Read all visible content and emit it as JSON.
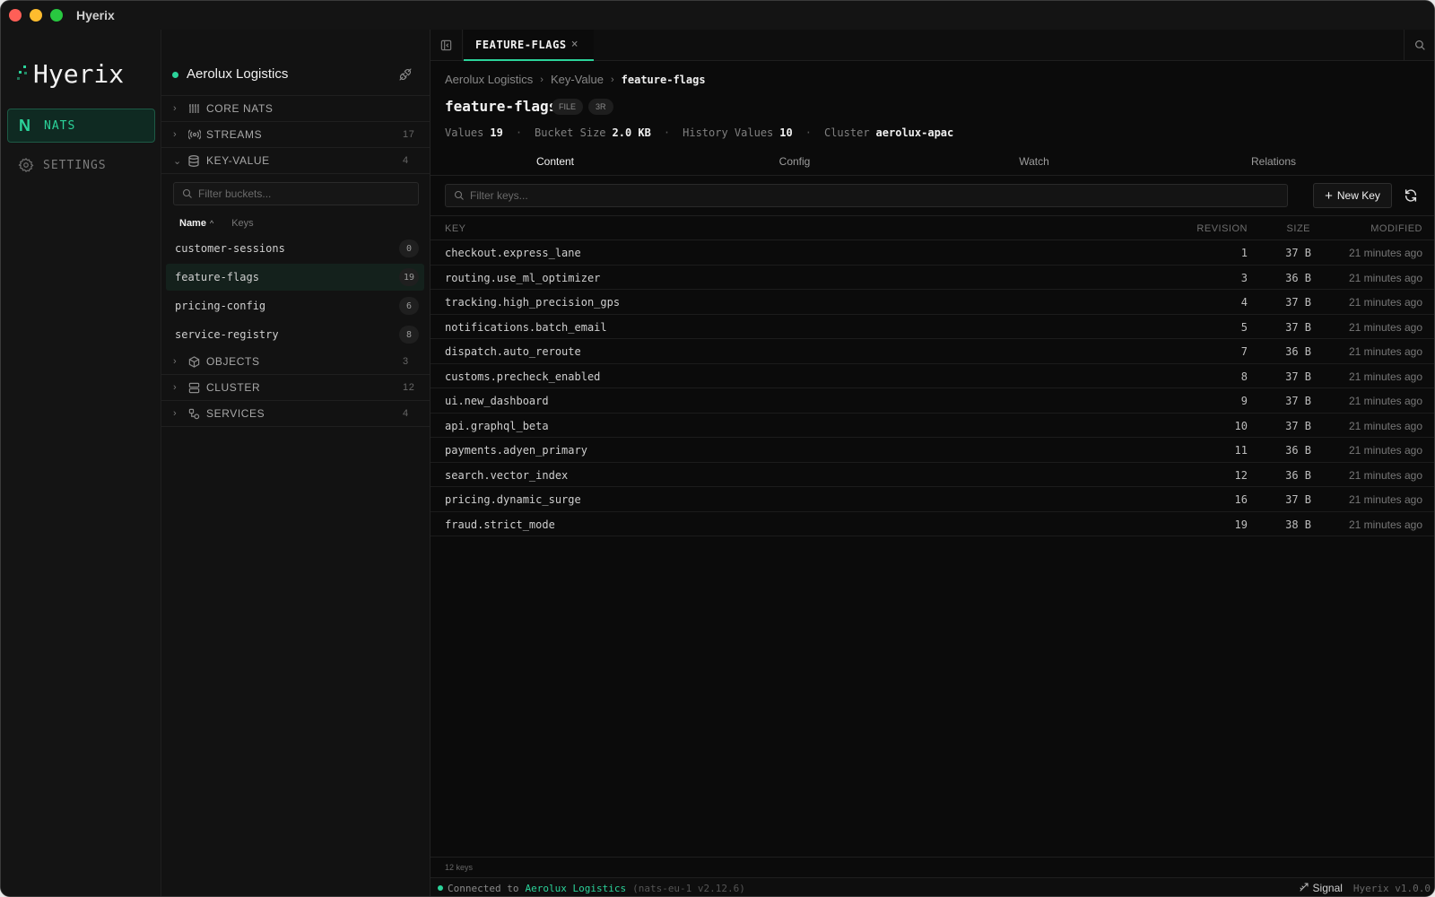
{
  "window": {
    "title": "Hyerix"
  },
  "nav": {
    "logo": "Hyerix",
    "items": [
      {
        "label": "NATS",
        "glyph": "N",
        "active": true
      },
      {
        "label": "SETTINGS",
        "icon": "gear-icon",
        "active": false
      }
    ]
  },
  "explorer": {
    "connection": {
      "name": "Aerolux Logistics",
      "status_color": "#2bd39a"
    },
    "sections": [
      {
        "label": "CORE NATS",
        "icon": "antenna-icon",
        "count": ""
      },
      {
        "label": "STREAMS",
        "icon": "broadcast-icon",
        "count": "17"
      },
      {
        "label": "KEY-VALUE",
        "icon": "database-icon",
        "count": "4",
        "expanded": true
      },
      {
        "label": "OBJECTS",
        "icon": "cube-icon",
        "count": "3"
      },
      {
        "label": "CLUSTER",
        "icon": "server-icon",
        "count": "12"
      },
      {
        "label": "SERVICES",
        "icon": "services-icon",
        "count": "4"
      }
    ],
    "bucket_filter_placeholder": "Filter buckets...",
    "sort": {
      "name": "Name",
      "keys": "Keys"
    },
    "buckets": [
      {
        "name": "customer-sessions",
        "count": "0"
      },
      {
        "name": "feature-flags",
        "count": "19",
        "active": true
      },
      {
        "name": "pricing-config",
        "count": "6"
      },
      {
        "name": "service-registry",
        "count": "8"
      }
    ]
  },
  "main": {
    "tab": {
      "label": "FEATURE-FLAGS",
      "close": "×"
    },
    "breadcrumb": [
      "Aerolux Logistics",
      "Key-Value",
      "feature-flags"
    ],
    "title": "feature-flags",
    "badges": [
      "FILE",
      "3R"
    ],
    "stats": [
      {
        "label": "Values",
        "value": "19"
      },
      {
        "label": "Bucket Size",
        "value": "2.0 KB"
      },
      {
        "label": "History Values",
        "value": "10"
      },
      {
        "label": "Cluster",
        "value": "aerolux-apac"
      }
    ],
    "subtabs": [
      "Content",
      "Config",
      "Watch",
      "Relations"
    ],
    "key_filter_placeholder": "Filter keys...",
    "new_key_label": "New Key",
    "columns": {
      "key": "KEY",
      "revision": "REVISION",
      "size": "SIZE",
      "modified": "MODIFIED"
    },
    "rows": [
      {
        "key": "checkout.express_lane",
        "revision": "1",
        "size": "37 B",
        "modified": "21 minutes ago"
      },
      {
        "key": "routing.use_ml_optimizer",
        "revision": "3",
        "size": "36 B",
        "modified": "21 minutes ago"
      },
      {
        "key": "tracking.high_precision_gps",
        "revision": "4",
        "size": "37 B",
        "modified": "21 minutes ago"
      },
      {
        "key": "notifications.batch_email",
        "revision": "5",
        "size": "37 B",
        "modified": "21 minutes ago"
      },
      {
        "key": "dispatch.auto_reroute",
        "revision": "7",
        "size": "36 B",
        "modified": "21 minutes ago"
      },
      {
        "key": "customs.precheck_enabled",
        "revision": "8",
        "size": "37 B",
        "modified": "21 minutes ago"
      },
      {
        "key": "ui.new_dashboard",
        "revision": "9",
        "size": "37 B",
        "modified": "21 minutes ago"
      },
      {
        "key": "api.graphql_beta",
        "revision": "10",
        "size": "37 B",
        "modified": "21 minutes ago"
      },
      {
        "key": "payments.adyen_primary",
        "revision": "11",
        "size": "36 B",
        "modified": "21 minutes ago"
      },
      {
        "key": "search.vector_index",
        "revision": "12",
        "size": "36 B",
        "modified": "21 minutes ago"
      },
      {
        "key": "pricing.dynamic_surge",
        "revision": "16",
        "size": "37 B",
        "modified": "21 minutes ago"
      },
      {
        "key": "fraud.strict_mode",
        "revision": "19",
        "size": "38 B",
        "modified": "21 minutes ago"
      }
    ],
    "footer_count": "12 keys"
  },
  "statusbar": {
    "prefix": "Connected to",
    "name": "Aerolux Logistics",
    "server": "(nats-eu-1 v2.12.6)",
    "signal": "Signal",
    "version": "Hyerix v1.0.0"
  },
  "colors": {
    "accent": "#2bd39a",
    "background": "#0b0b0b"
  }
}
